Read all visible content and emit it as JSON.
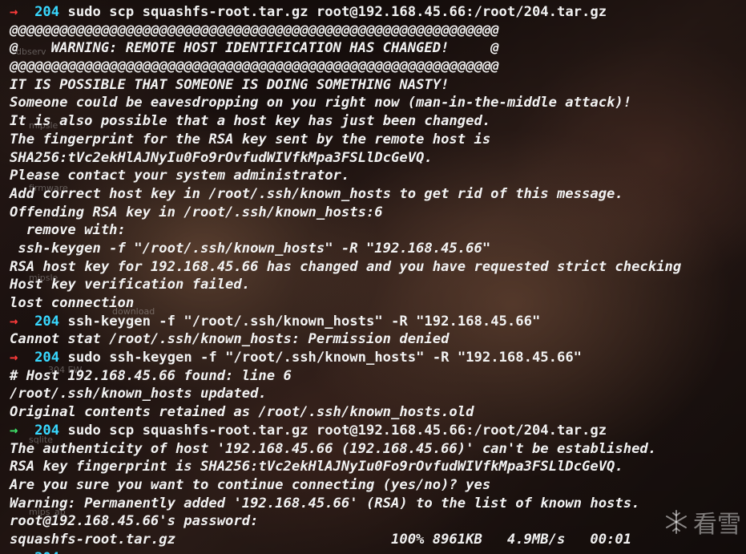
{
  "desktop_labels": [
    "dbserv",
    "mipsle",
    "firmware",
    "mipsle",
    "download",
    "304 EW",
    "sqlite",
    "mips_ap"
  ],
  "lines": [
    {
      "kind": "prompt",
      "arrow": "→",
      "arrow_color": "red",
      "dir": "204",
      "text": "sudo scp squashfs-root.tar.gz root@192.168.45.66:/root/204.tar.gz"
    },
    {
      "kind": "out",
      "text": "@@@@@@@@@@@@@@@@@@@@@@@@@@@@@@@@@@@@@@@@@@@@@@@@@@@@@@@@@@@"
    },
    {
      "kind": "out",
      "text": "@    WARNING: REMOTE HOST IDENTIFICATION HAS CHANGED!     @"
    },
    {
      "kind": "out",
      "text": "@@@@@@@@@@@@@@@@@@@@@@@@@@@@@@@@@@@@@@@@@@@@@@@@@@@@@@@@@@@"
    },
    {
      "kind": "out",
      "text": "IT IS POSSIBLE THAT SOMEONE IS DOING SOMETHING NASTY!"
    },
    {
      "kind": "out",
      "text": "Someone could be eavesdropping on you right now (man-in-the-middle attack)!"
    },
    {
      "kind": "out",
      "text": "It is also possible that a host key has just been changed."
    },
    {
      "kind": "out",
      "text": "The fingerprint for the RSA key sent by the remote host is"
    },
    {
      "kind": "out",
      "text": "SHA256:tVc2ekHlAJNyIu0Fo9rOvfudWIVfkMpa3FSLlDcGeVQ."
    },
    {
      "kind": "out",
      "text": "Please contact your system administrator."
    },
    {
      "kind": "out",
      "text": "Add correct host key in /root/.ssh/known_hosts to get rid of this message."
    },
    {
      "kind": "out",
      "text": "Offending RSA key in /root/.ssh/known_hosts:6"
    },
    {
      "kind": "out",
      "text": "  remove with:"
    },
    {
      "kind": "out",
      "text": " ssh-keygen -f \"/root/.ssh/known_hosts\" -R \"192.168.45.66\""
    },
    {
      "kind": "out",
      "text": "RSA host key for 192.168.45.66 has changed and you have requested strict checking"
    },
    {
      "kind": "out",
      "text": "Host key verification failed."
    },
    {
      "kind": "out",
      "text": "lost connection"
    },
    {
      "kind": "prompt",
      "arrow": "→",
      "arrow_color": "red",
      "dir": "204",
      "text": "ssh-keygen -f \"/root/.ssh/known_hosts\" -R \"192.168.45.66\""
    },
    {
      "kind": "out",
      "text": "Cannot stat /root/.ssh/known_hosts: Permission denied"
    },
    {
      "kind": "prompt",
      "arrow": "→",
      "arrow_color": "red",
      "dir": "204",
      "text": "sudo ssh-keygen -f \"/root/.ssh/known_hosts\" -R \"192.168.45.66\""
    },
    {
      "kind": "out",
      "text": "# Host 192.168.45.66 found: line 6"
    },
    {
      "kind": "out",
      "text": "/root/.ssh/known_hosts updated."
    },
    {
      "kind": "out",
      "text": "Original contents retained as /root/.ssh/known_hosts.old"
    },
    {
      "kind": "prompt",
      "arrow": "→",
      "arrow_color": "green",
      "dir": "204",
      "text": "sudo scp squashfs-root.tar.gz root@192.168.45.66:/root/204.tar.gz"
    },
    {
      "kind": "out",
      "text": "The authenticity of host '192.168.45.66 (192.168.45.66)' can't be established."
    },
    {
      "kind": "out",
      "text": "RSA key fingerprint is SHA256:tVc2ekHlAJNyIu0Fo9rOvfudWIVfkMpa3FSLlDcGeVQ."
    },
    {
      "kind": "out",
      "text": "Are you sure you want to continue connecting (yes/no)? yes"
    },
    {
      "kind": "out",
      "text": "Warning: Permanently added '192.168.45.66' (RSA) to the list of known hosts."
    },
    {
      "kind": "out",
      "text": "root@192.168.45.66's password:"
    },
    {
      "kind": "out",
      "text": "squashfs-root.tar.gz                          100% 8961KB   4.9MB/s   00:01"
    },
    {
      "kind": "prompt",
      "arrow": "→",
      "arrow_color": "green",
      "dir": "204",
      "text": ""
    }
  ],
  "watermark": {
    "text": "看雪",
    "icon": "snowflake-icon"
  },
  "colors": {
    "arrow_red": "#ff3b3b",
    "arrow_green": "#3fe36a",
    "prompt_dir": "#38d8ff",
    "text": "#f2f2f2"
  }
}
